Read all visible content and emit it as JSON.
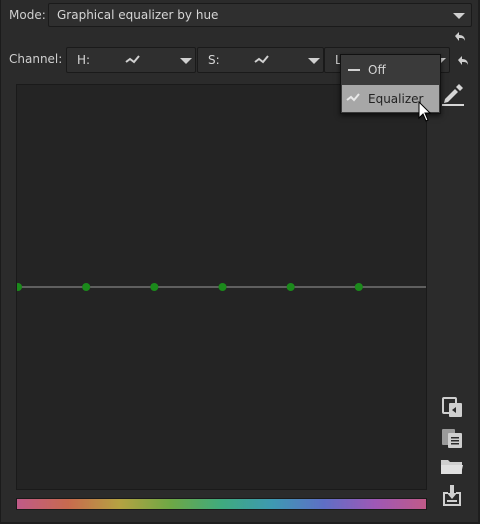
{
  "mode": {
    "label": "Mode:",
    "value": "Graphical equalizer by hue"
  },
  "channel": {
    "label": "Channel:",
    "selectors": [
      {
        "name": "H:"
      },
      {
        "name": "S:"
      },
      {
        "name": "L"
      }
    ]
  },
  "dropdown_menu": {
    "items": [
      {
        "label": "Off",
        "icon": "flat-line-icon"
      },
      {
        "label": "Equalizer",
        "icon": "curve-icon"
      }
    ],
    "selected": "Equalizer"
  },
  "graph": {
    "line_color": "#9a9a9a",
    "node_color": "#1b8a1b",
    "nodes": [
      0,
      0.1667,
      0.3333,
      0.5,
      0.6667,
      0.8333
    ],
    "level": 0.5
  },
  "side_icons": [
    "reset-icon",
    "reset-icon",
    "picker-icon",
    "copy-icon",
    "paste-icon",
    "open-folder-icon",
    "save-icon"
  ]
}
